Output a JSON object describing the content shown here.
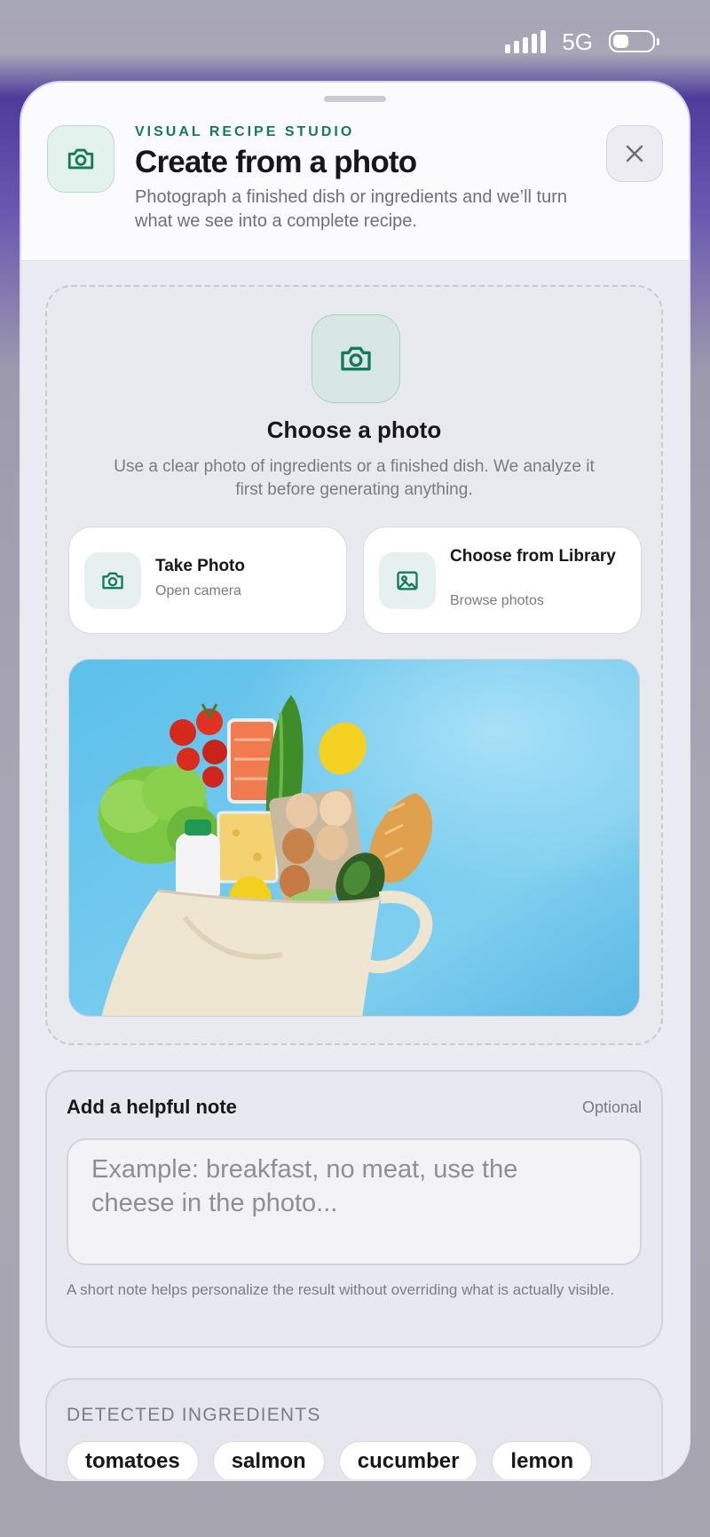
{
  "status_bar": {
    "network": "5G"
  },
  "header": {
    "eyebrow": "VISUAL RECIPE STUDIO",
    "title": "Create from a photo",
    "subtitle": "Photograph a finished dish or ingredients and we’ll turn what we see into a complete recipe.",
    "icon": "camera-icon",
    "close_icon": "close-icon"
  },
  "upload": {
    "title": "Choose a photo",
    "description": "Use a clear photo of ingredients or a finished dish. We analyze it first before generating anything.",
    "options": [
      {
        "title": "Take Photo",
        "subtitle": "Open camera",
        "icon": "camera-icon"
      },
      {
        "title": "Choose from Library",
        "subtitle": "Browse photos",
        "icon": "image-icon"
      }
    ]
  },
  "note": {
    "title": "Add a helpful note",
    "optional_label": "Optional",
    "placeholder": "Example: breakfast, no meat, use the cheese in the photo...",
    "help": "A short note helps personalize the result without overriding what is actually visible."
  },
  "detected": {
    "label": "DETECTED INGREDIENTS",
    "items": [
      "tomatoes",
      "salmon",
      "cucumber",
      "lemon"
    ]
  },
  "colors": {
    "accent": "#147a5c",
    "sheet_background": "#ebebf3",
    "photo_background": "#59b9e6"
  }
}
